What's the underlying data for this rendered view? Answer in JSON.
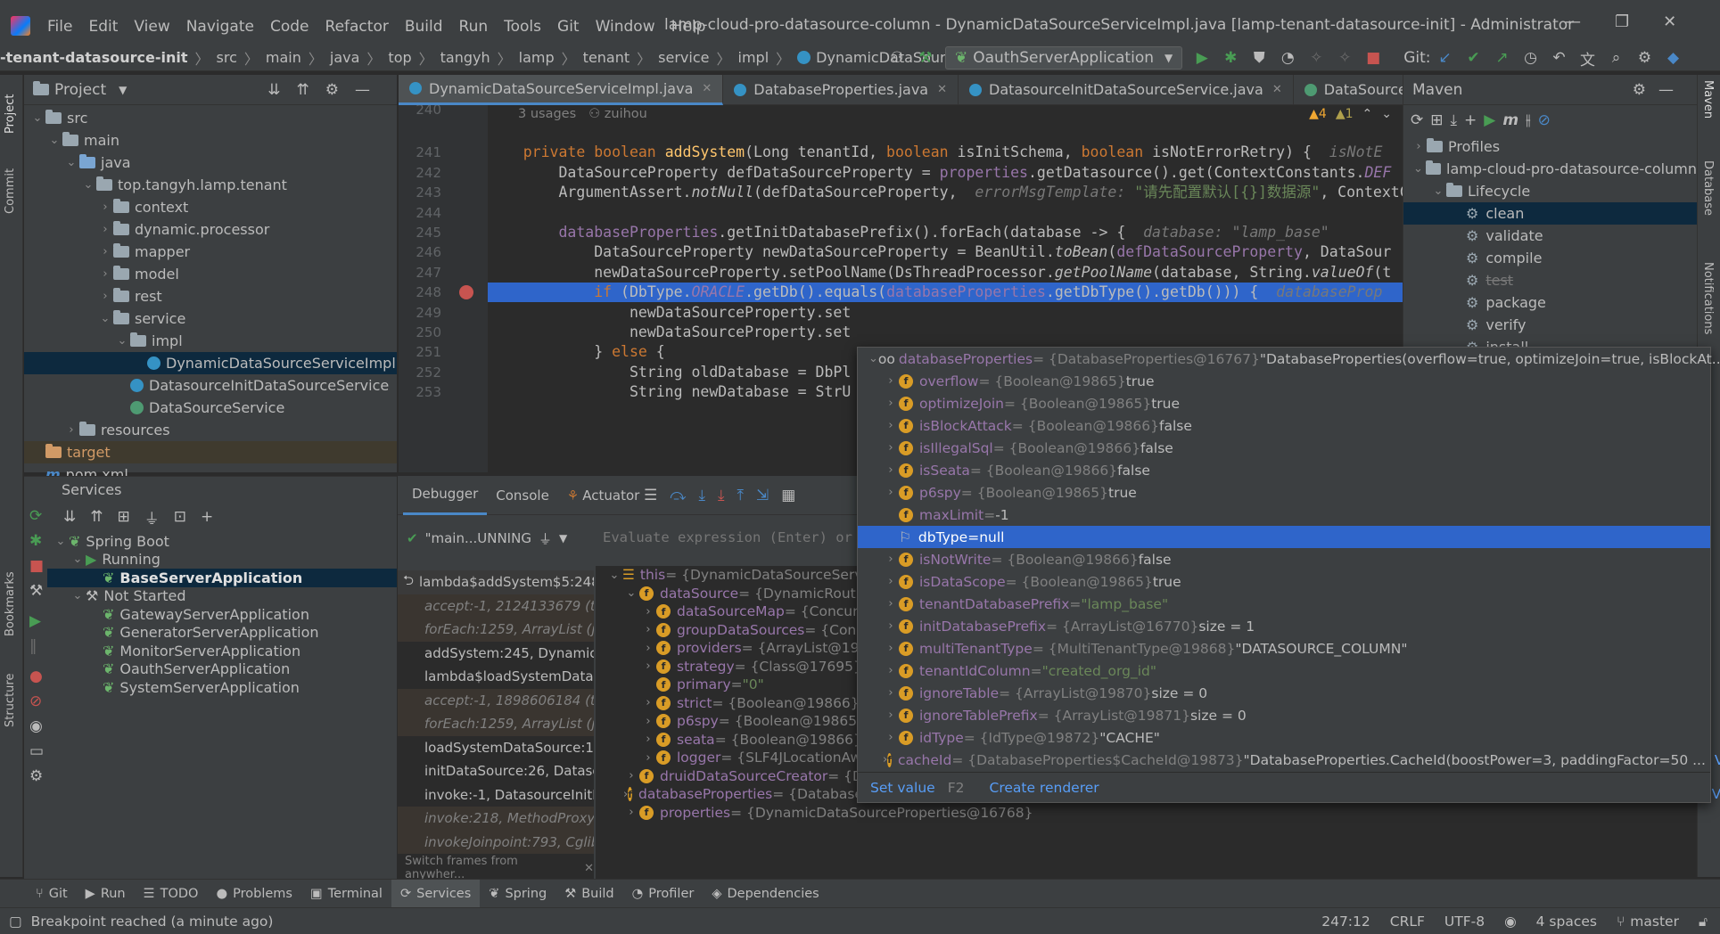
{
  "menu": [
    "File",
    "Edit",
    "View",
    "Navigate",
    "Code",
    "Refactor",
    "Build",
    "Run",
    "Tools",
    "Git",
    "Window",
    "Help"
  ],
  "window_title": "lamp-cloud-pro-datasource-column - DynamicDataSourceServiceImpl.java [lamp-tenant-datasource-init] - Administrator",
  "breadcrumbs": [
    "-tenant-datasource-init",
    "src",
    "main",
    "java",
    "top",
    "tangyh",
    "lamp",
    "tenant",
    "service",
    "impl",
    "DynamicDataSourceServiceImpl"
  ],
  "run_config": "OauthServerApplication",
  "git_label": "Git:",
  "project_panel": {
    "title": "Project",
    "tree": [
      {
        "label": "src",
        "depth": 0,
        "type": "folder",
        "open": true
      },
      {
        "label": "main",
        "depth": 1,
        "type": "folder",
        "open": true
      },
      {
        "label": "java",
        "depth": 2,
        "type": "src",
        "open": true
      },
      {
        "label": "top.tangyh.lamp.tenant",
        "depth": 3,
        "type": "folder",
        "open": true
      },
      {
        "label": "context",
        "depth": 4,
        "type": "folder",
        "open": false
      },
      {
        "label": "dynamic.processor",
        "depth": 4,
        "type": "folder",
        "open": false
      },
      {
        "label": "mapper",
        "depth": 4,
        "type": "folder",
        "open": false
      },
      {
        "label": "model",
        "depth": 4,
        "type": "folder",
        "open": false
      },
      {
        "label": "rest",
        "depth": 4,
        "type": "folder",
        "open": false
      },
      {
        "label": "service",
        "depth": 4,
        "type": "folder",
        "open": true
      },
      {
        "label": "impl",
        "depth": 5,
        "type": "folder",
        "open": true
      },
      {
        "label": "DynamicDataSourceServiceImpl",
        "depth": 6,
        "type": "class",
        "selected": true
      },
      {
        "label": "DatasourceInitDataSourceService",
        "depth": 5,
        "type": "class"
      },
      {
        "label": "DataSourceService",
        "depth": 5,
        "type": "interface"
      },
      {
        "label": "resources",
        "depth": 2,
        "type": "folder",
        "open": false
      },
      {
        "label": "target",
        "depth": 0,
        "type": "orange"
      },
      {
        "label": "pom.xml",
        "depth": 0,
        "type": "maven"
      }
    ]
  },
  "editor_tabs": [
    {
      "label": "DynamicDataSourceServiceImpl.java",
      "active": true
    },
    {
      "label": "DatabaseProperties.java"
    },
    {
      "label": "DatasourceInitDataSourceService.java"
    },
    {
      "label": "DataSourceServi"
    }
  ],
  "editor": {
    "warnings": "▲4",
    "weak_warnings": "▲1",
    "usages": "3 usages",
    "author": "zuihou",
    "lines": [
      {
        "n": "240",
        "segs": []
      },
      {
        "n": "241",
        "segs": [
          [
            "kw",
            "    private boolean "
          ],
          [
            "fn",
            "addSystem"
          ],
          [
            "",
            "(Long tenantId, "
          ],
          [
            "kw",
            "boolean "
          ],
          [
            "",
            "isInitSchema, "
          ],
          [
            "kw",
            "boolean "
          ],
          [
            "",
            "isNotErrorRetry) {  "
          ],
          [
            "hint",
            "isNotE"
          ]
        ]
      },
      {
        "n": "242",
        "segs": [
          [
            "",
            "        DataSourceProperty defDataSourceProperty = "
          ],
          [
            "fld",
            "properties"
          ],
          [
            "",
            ".getDatasource().get(ContextConstants."
          ],
          [
            "fld st",
            "DEF"
          ]
        ]
      },
      {
        "n": "243",
        "segs": [
          [
            "",
            "        ArgumentAssert."
          ],
          [
            "st",
            "notNull"
          ],
          [
            "",
            "(defDataSourceProperty,  "
          ],
          [
            "hint",
            "errorMsgTemplate: "
          ],
          [
            "str",
            "\"请先配置默认[{}]数据源\""
          ],
          [
            "",
            ", ContextCo"
          ]
        ]
      },
      {
        "n": "244",
        "segs": []
      },
      {
        "n": "245",
        "segs": [
          [
            "",
            "        "
          ],
          [
            "fld",
            "databaseProperties"
          ],
          [
            "",
            ".getInitDatabasePrefix().forEach(database -> {  "
          ],
          [
            "hint",
            "database: \"lamp_base\""
          ]
        ]
      },
      {
        "n": "246",
        "segs": [
          [
            "",
            "            DataSourceProperty newDataSourceProperty = BeanUtil."
          ],
          [
            "st",
            "toBean"
          ],
          [
            "",
            "("
          ],
          [
            "fld",
            "defDataSourceProperty"
          ],
          [
            "",
            ", DataSour"
          ]
        ]
      },
      {
        "n": "247",
        "segs": [
          [
            "",
            "            newDataSourceProperty.setPoolName(DsThreadProcessor."
          ],
          [
            "st",
            "getPoolName"
          ],
          [
            "",
            "(database, String."
          ],
          [
            "st",
            "valueOf"
          ],
          [
            "",
            "(t"
          ]
        ]
      },
      {
        "n": "248",
        "segs": [
          [
            "",
            "            "
          ],
          [
            "kw",
            "if "
          ],
          [
            "",
            "(DbType."
          ],
          [
            "fld st",
            "ORACLE"
          ],
          [
            "",
            ".getDb().equals("
          ],
          [
            "fld",
            "databaseProperties"
          ],
          [
            "",
            ".getDbType().getDb())) {  "
          ],
          [
            "hint",
            "databaseProp"
          ]
        ],
        "highlight": true
      },
      {
        "n": "249",
        "segs": [
          [
            "",
            "                newDataSourceProperty.set"
          ]
        ]
      },
      {
        "n": "250",
        "segs": [
          [
            "",
            "                newDataSourceProperty.set"
          ]
        ]
      },
      {
        "n": "251",
        "segs": [
          [
            "",
            "            } "
          ],
          [
            "kw",
            "else "
          ],
          [
            "",
            "{"
          ]
        ]
      },
      {
        "n": "252",
        "segs": [
          [
            "",
            "                String oldDatabase = DbPl"
          ]
        ]
      },
      {
        "n": "253",
        "segs": [
          [
            "",
            "                String newDatabase = StrU"
          ]
        ]
      }
    ]
  },
  "maven": {
    "title": "Maven",
    "items": [
      {
        "label": "Profiles",
        "depth": 0,
        "chev": "›"
      },
      {
        "label": "lamp-cloud-pro-datasource-column",
        "depth": 0,
        "chev": "⌄"
      },
      {
        "label": "Lifecycle",
        "depth": 1,
        "chev": "⌄"
      },
      {
        "label": "clean",
        "depth": 2,
        "selected": true
      },
      {
        "label": "validate",
        "depth": 2
      },
      {
        "label": "compile",
        "depth": 2
      },
      {
        "label": "test",
        "depth": 2,
        "strike": true
      },
      {
        "label": "package",
        "depth": 2
      },
      {
        "label": "verify",
        "depth": 2
      },
      {
        "label": "install",
        "depth": 2
      }
    ]
  },
  "popup": {
    "header": {
      "name": "databaseProperties",
      "type": " = {DatabaseProperties@16767} ",
      "value": "\"DatabaseProperties(overflow=true, optimizeJoin=true, isBlockAt...",
      "link": "View"
    },
    "rows": [
      {
        "name": "overflow",
        "type": " = {Boolean@19865} ",
        "value": "true",
        "exp": true
      },
      {
        "name": "optimizeJoin",
        "type": " = {Boolean@19865} ",
        "value": "true",
        "exp": true
      },
      {
        "name": "isBlockAttack",
        "type": " = {Boolean@19866} ",
        "value": "false",
        "exp": true
      },
      {
        "name": "isIllegalSql",
        "type": " = {Boolean@19866} ",
        "value": "false",
        "exp": true
      },
      {
        "name": "isSeata",
        "type": " = {Boolean@19866} ",
        "value": "false",
        "exp": true
      },
      {
        "name": "p6spy",
        "type": " = {Boolean@19865} ",
        "value": "true",
        "exp": true
      },
      {
        "name": "maxLimit",
        "type": " = ",
        "value": "-1",
        "exp": false
      },
      {
        "name": "dbType",
        "type": " = ",
        "value": "null",
        "exp": false,
        "selected": true,
        "flag": true
      },
      {
        "name": "isNotWrite",
        "type": " = {Boolean@19866} ",
        "value": "false",
        "exp": true
      },
      {
        "name": "isDataScope",
        "type": " = {Boolean@19865} ",
        "value": "true",
        "exp": true
      },
      {
        "name": "tenantDatabasePrefix",
        "type": " = ",
        "value": "\"lamp_base\"",
        "exp": true,
        "strval": true
      },
      {
        "name": "initDatabasePrefix",
        "type": " = {ArrayList@16770} ",
        "value": " size = 1",
        "exp": true
      },
      {
        "name": "multiTenantType",
        "type": " = {MultiTenantType@19868} ",
        "value": "\"DATASOURCE_COLUMN\"",
        "exp": true
      },
      {
        "name": "tenantIdColumn",
        "type": " = ",
        "value": "\"created_org_id\"",
        "exp": true,
        "strval": true
      },
      {
        "name": "ignoreTable",
        "type": " = {ArrayList@19870} ",
        "value": " size = 0",
        "exp": true
      },
      {
        "name": "ignoreTablePrefix",
        "type": " = {ArrayList@19871} ",
        "value": " size = 0",
        "exp": true
      },
      {
        "name": "idType",
        "type": " = {IdType@19872} ",
        "value": "\"CACHE\"",
        "exp": true
      },
      {
        "name": "cacheId",
        "type": " = {DatabaseProperties$CacheId@19873} ",
        "value": "\"DatabaseProperties.CacheId(boostPower=3, paddingFactor=50 ...",
        "exp": true,
        "link": "View"
      }
    ],
    "set_value": "Set value",
    "set_value_key": "F2",
    "create_renderer": "Create renderer"
  },
  "services": {
    "title": "Services",
    "tree": [
      {
        "label": "Spring Boot",
        "depth": 0,
        "chev": "⌄",
        "icon": "spring"
      },
      {
        "label": "Running",
        "depth": 1,
        "chev": "⌄",
        "icon": "run"
      },
      {
        "label": "BaseServerApplication",
        "depth": 2,
        "icon": "spring",
        "selected": true,
        "bold": true
      },
      {
        "label": "Not Started",
        "depth": 1,
        "chev": "⌄",
        "icon": "wrench"
      },
      {
        "label": "GatewayServerApplication",
        "depth": 2,
        "icon": "spring"
      },
      {
        "label": "GeneratorServerApplication",
        "depth": 2,
        "icon": "spring"
      },
      {
        "label": "MonitorServerApplication",
        "depth": 2,
        "icon": "spring"
      },
      {
        "label": "OauthServerApplication",
        "depth": 2,
        "icon": "spring"
      },
      {
        "label": "SystemServerApplication",
        "depth": 2,
        "icon": "spring"
      }
    ]
  },
  "debugger": {
    "tabs": [
      "Debugger",
      "Console",
      "Actuator"
    ],
    "thread": "\"main...UNNING",
    "eval_placeholder": "Evaluate expression (Enter) or a",
    "frames": [
      {
        "label": "lambda$addSystem$5:248",
        "current": true
      },
      {
        "label": "accept:-1, 2124133679 (to",
        "lib": true
      },
      {
        "label": "forEach:1259, ArrayList (ja",
        "lib": true
      },
      {
        "label": "addSystem:245, DynamicD"
      },
      {
        "label": "lambda$loadSystemDataS"
      },
      {
        "label": "accept:-1, 1898606184 (to",
        "lib": true
      },
      {
        "label": "forEach:1259, ArrayList (ja",
        "lib": true
      },
      {
        "label": "loadSystemDataSource:17"
      },
      {
        "label": "initDataSource:26, Dataso"
      },
      {
        "label": "invoke:-1, DatasourceInitD"
      },
      {
        "label": "invoke:218, MethodProxy",
        "lib": true
      },
      {
        "label": "invokeJoinpoint:793, Cglib",
        "lib": true
      }
    ],
    "switch_frames": "Switch frames from anywher...",
    "vars": [
      {
        "name": "this",
        "type": " = {DynamicDataSourceServic",
        "value": "",
        "depth": 0,
        "chev": "⌄",
        "icon": "list"
      },
      {
        "name": "dataSource",
        "type": " = {DynamicRoutin",
        "value": "",
        "depth": 1,
        "chev": "⌄",
        "icon": "f"
      },
      {
        "name": "dataSourceMap",
        "type": " = {Concur",
        "value": "",
        "depth": 2,
        "chev": "›",
        "icon": "f"
      },
      {
        "name": "groupDataSources",
        "type": " = {Conc",
        "value": "",
        "depth": 2,
        "chev": "›",
        "icon": "f"
      },
      {
        "name": "providers",
        "type": " = {ArrayList@19",
        "value": "",
        "depth": 2,
        "chev": "›",
        "icon": "f"
      },
      {
        "name": "strategy",
        "type": " = {Class@17695} ",
        "value": "",
        "depth": 2,
        "chev": "›",
        "icon": "f"
      },
      {
        "name": "primary",
        "type": " = ",
        "value": "\"0\"",
        "depth": 2,
        "chev": "",
        "icon": "f",
        "strval": true
      },
      {
        "name": "strict",
        "type": " = {Boolean@19866} ",
        "value": "f",
        "depth": 2,
        "chev": "›",
        "icon": "f"
      },
      {
        "name": "p6spy",
        "type": " = {Boolean@19865} ",
        "value": "",
        "depth": 2,
        "chev": "›",
        "icon": "f"
      },
      {
        "name": "seata",
        "type": " = {Boolean@19866} ",
        "value": "f",
        "depth": 2,
        "chev": "›",
        "icon": "f"
      },
      {
        "name": "logger",
        "type": " = {SLF4JLocationAwareLog@19809}",
        "value": "",
        "depth": 2,
        "chev": "›",
        "icon": "f"
      },
      {
        "name": "druidDataSourceCreator",
        "type": " = {DruidDataSourceCreator@16778}",
        "value": "",
        "depth": 1,
        "chev": "›",
        "icon": "f"
      },
      {
        "name": "databaseProperties",
        "type": " = {DatabaseProperties@16767} ",
        "value": "\"DatabaseProperties(overflow=true, optimizeJoin=true, isBlockAttack=false, isIllegalSql=false, isSe...",
        "depth": 1,
        "chev": "›",
        "icon": "f",
        "link": "View"
      },
      {
        "name": "properties",
        "type": " = {DynamicDataSourceProperties@16768}",
        "value": "",
        "depth": 1,
        "chev": "›",
        "icon": "f"
      }
    ]
  },
  "bottom_tabs": [
    {
      "label": "Git",
      "icon": "⑂"
    },
    {
      "label": "Run",
      "icon": "▶"
    },
    {
      "label": "TODO",
      "icon": "☰"
    },
    {
      "label": "Problems",
      "icon": "●"
    },
    {
      "label": "Terminal",
      "icon": "▣"
    },
    {
      "label": "Services",
      "icon": "⟳",
      "active": true
    },
    {
      "label": "Spring",
      "icon": "❦"
    },
    {
      "label": "Build",
      "icon": "⚒"
    },
    {
      "label": "Profiler",
      "icon": "◔"
    },
    {
      "label": "Dependencies",
      "icon": "◈"
    }
  ],
  "status": {
    "message": "Breakpoint reached (a minute ago)",
    "position": "247:12",
    "line_sep": "CRLF",
    "encoding": "UTF-8",
    "indent": "4 spaces",
    "branch": "master"
  },
  "left_strip": [
    "Project",
    "Commit",
    "Bookmarks",
    "Structure"
  ],
  "right_strip": [
    "Maven",
    "Database",
    "Notifications"
  ],
  "colors": {
    "accent": "#2f65ca",
    "keyword": "#cc7832",
    "field": "#9876aa",
    "string": "#6a8759",
    "method": "#ffc66d",
    "green": "#499c54",
    "red": "#c75450"
  }
}
